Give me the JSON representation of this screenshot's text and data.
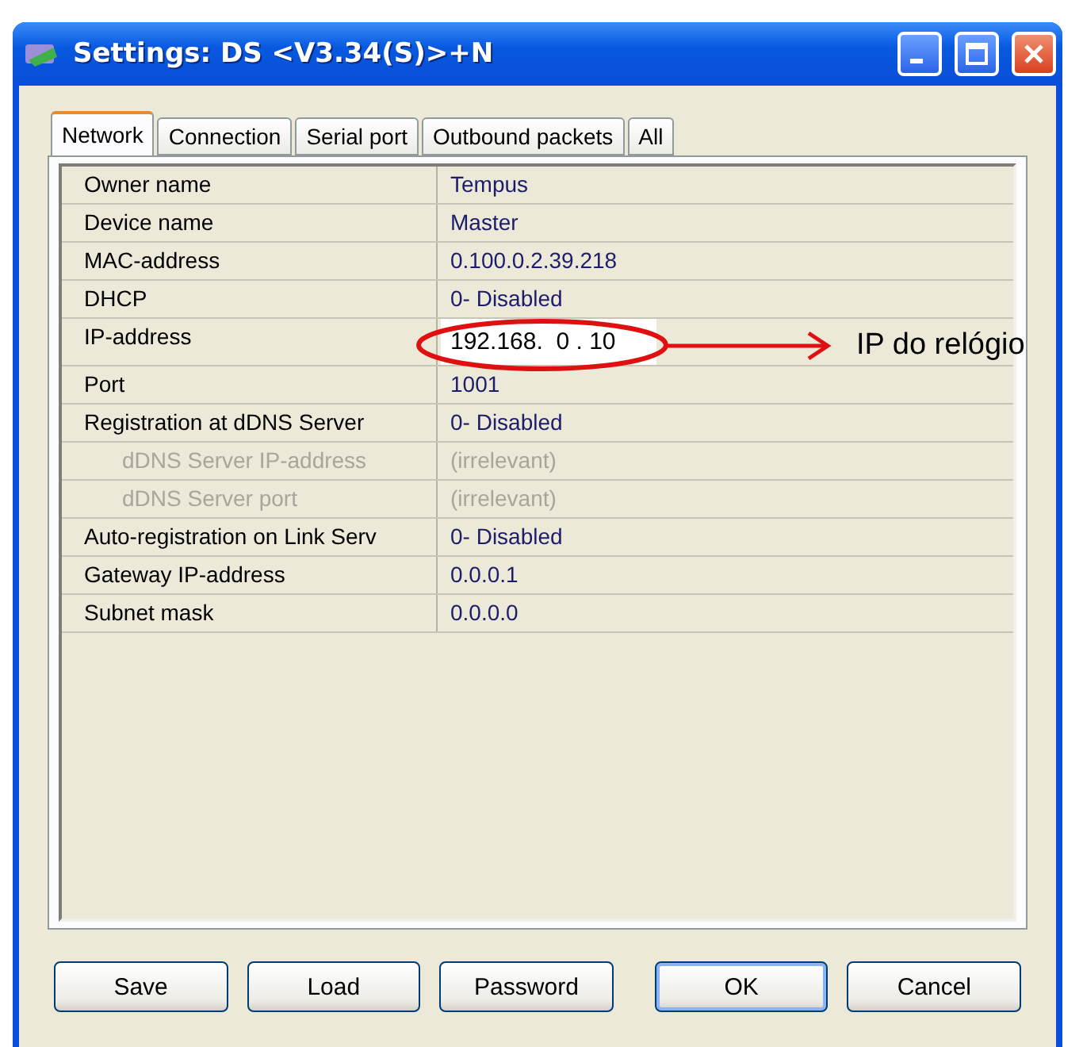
{
  "window": {
    "title": "Settings: DS <V3.34(S)>+N"
  },
  "tabs": [
    {
      "label": "Network",
      "selected": true
    },
    {
      "label": "Connection",
      "selected": false
    },
    {
      "label": "Serial port",
      "selected": false
    },
    {
      "label": "Outbound packets",
      "selected": false
    },
    {
      "label": "All",
      "selected": false
    }
  ],
  "properties": [
    {
      "name": "Owner name",
      "value": "Tempus",
      "disabled": false,
      "editing": false
    },
    {
      "name": "Device name",
      "value": "Master",
      "disabled": false,
      "editing": false
    },
    {
      "name": "MAC-address",
      "value": "0.100.0.2.39.218",
      "disabled": false,
      "editing": false
    },
    {
      "name": "DHCP",
      "value": "0- Disabled",
      "disabled": false,
      "editing": false
    },
    {
      "name": "IP-address",
      "value": "192.168.  0 . 10",
      "disabled": false,
      "editing": true
    },
    {
      "name": "Port",
      "value": "1001",
      "disabled": false,
      "editing": false
    },
    {
      "name": "Registration at dDNS Server",
      "value": "0- Disabled",
      "disabled": false,
      "editing": false
    },
    {
      "name": "dDNS Server IP-address",
      "value": "(irrelevant)",
      "disabled": true,
      "editing": false
    },
    {
      "name": "dDNS Server port",
      "value": "(irrelevant)",
      "disabled": true,
      "editing": false
    },
    {
      "name": "Auto-registration on Link Serv",
      "value": "0- Disabled",
      "disabled": false,
      "editing": false
    },
    {
      "name": "Gateway IP-address",
      "value": "0.0.0.1",
      "disabled": false,
      "editing": false
    },
    {
      "name": "Subnet mask",
      "value": "0.0.0.0",
      "disabled": false,
      "editing": false
    }
  ],
  "buttons": [
    {
      "label": "Save",
      "default": false
    },
    {
      "label": "Load",
      "default": false
    },
    {
      "label": "Password",
      "default": false
    },
    {
      "label": "OK",
      "default": true
    },
    {
      "label": "Cancel",
      "default": false
    }
  ],
  "annotation": {
    "label": "IP do relógio"
  }
}
